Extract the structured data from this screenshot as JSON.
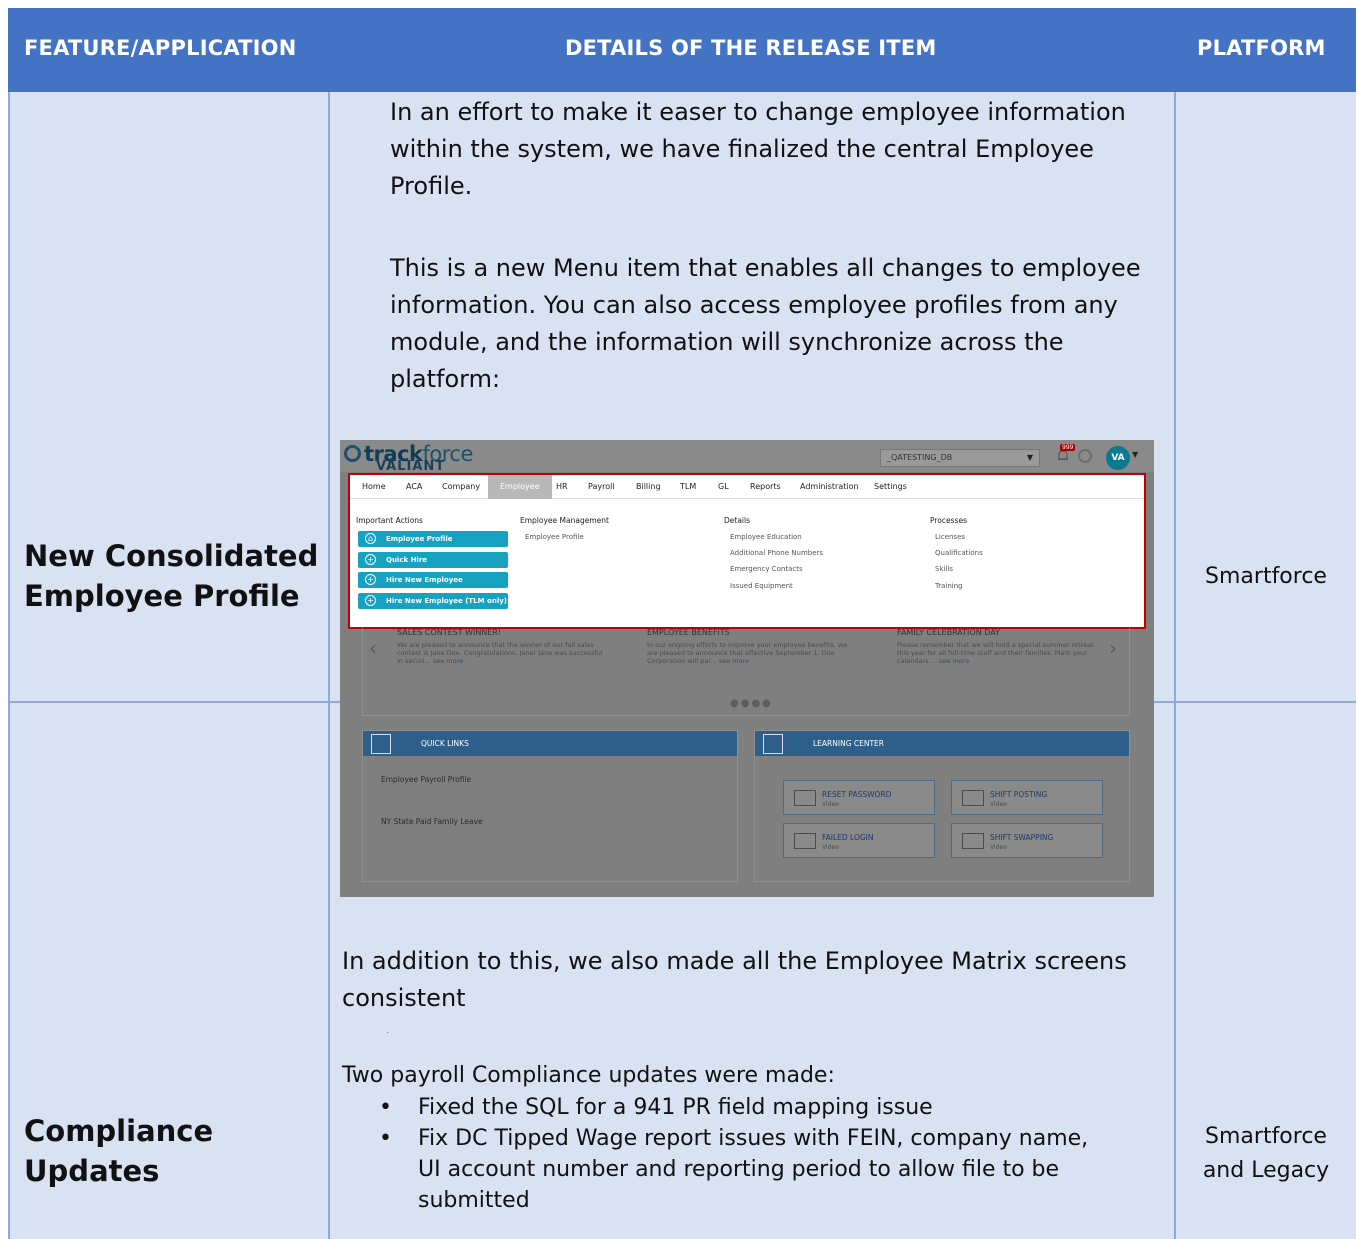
{
  "headers": {
    "feature": "FEATURE/APPLICATION",
    "details": "DETAILS OF THE RELEASE ITEM",
    "platform": "PLATFORM"
  },
  "rows": [
    {
      "feature_line1": "New Consolidated",
      "feature_line2": "Employee Profile",
      "platform": "Smartforce",
      "para1": [
        "In an effort to make it easer to change employee information",
        "within the system, we have finalized the central Employee",
        "Profile."
      ],
      "para2": [
        "This is a new Menu item that enables all changes to employee",
        "information.  You can also access employee profiles from any",
        "module, and the information will synchronize across the",
        "platform:"
      ],
      "para3": [
        "In addition to this, we also made all the Employee Matrix screens",
        "consistent"
      ],
      "trailing_dot": "."
    },
    {
      "feature_line1": "Compliance",
      "feature_line2": "Updates",
      "platform_line1": "Smartforce",
      "platform_line2": "and Legacy",
      "intro": "Two payroll Compliance updates were made:",
      "bullets": [
        "Fixed the SQL for a 941 PR field mapping issue",
        "Fix DC Tipped Wage report issues with FEIN, company name,"
      ],
      "bullet2_cont": [
        "UI account number and reporting period to allow file to be",
        "submitted"
      ]
    }
  ],
  "screenshot": {
    "logo_track": "track",
    "logo_force": "force",
    "logo_valiant": "VALIANT",
    "db_select": "_QATESTING_DB",
    "notification_count": "999",
    "avatar": "VA",
    "nav": [
      "Home",
      "ACA",
      "Company",
      "Employee",
      "HR",
      "Payroll",
      "Billing",
      "TLM",
      "GL",
      "Reports",
      "Administration",
      "Settings"
    ],
    "important_actions_title": "Important Actions",
    "actions": [
      "Employee Profile",
      "Quick Hire",
      "Hire New Employee",
      "Hire New Employee (TLM only)"
    ],
    "emp_mgmt_title": "Employee Management",
    "emp_mgmt_items": [
      "Employee Profile"
    ],
    "details_title": "Details",
    "details_items": [
      "Employee Education",
      "Additional Phone Numbers",
      "Emergency Contacts",
      "Issued Equipment"
    ],
    "processes_title": "Processes",
    "processes_items": [
      "Licenses",
      "Qualifications",
      "Skills",
      "Training"
    ],
    "announcements": [
      {
        "title": "SALES CONTEST WINNER!",
        "body": "We are pleased to announce that the winner of our fall sales contest is Jane Doe. Congratulations, Jane! Jane was successful in securi...",
        "more": "see more"
      },
      {
        "title": "EMPLOYEE BENEFITS",
        "body": "In our ongoing efforts to improve your employee benefits, we are pleased to announce that effective September 1, Doe Corporation will par...",
        "more": "see more"
      },
      {
        "title": "FAMILY CELEBRATION DAY",
        "body": "Please remember that we will hold a special summer retreat this year for all full-time staff and their families. Mark your calendars ...",
        "more": "see more"
      }
    ],
    "quick_links_title": "QUICK LINKS",
    "quick_links": [
      "Employee Payroll Profile",
      "NY State Paid Family Leave"
    ],
    "learning_title": "LEARNING CENTER",
    "videos": [
      {
        "title": "RESET PASSWORD",
        "sub": "Video"
      },
      {
        "title": "SHIFT POSTING",
        "sub": "Video"
      },
      {
        "title": "FAILED LOGIN",
        "sub": "Video"
      },
      {
        "title": "SHIFT SWAPPING",
        "sub": "Video"
      }
    ]
  }
}
